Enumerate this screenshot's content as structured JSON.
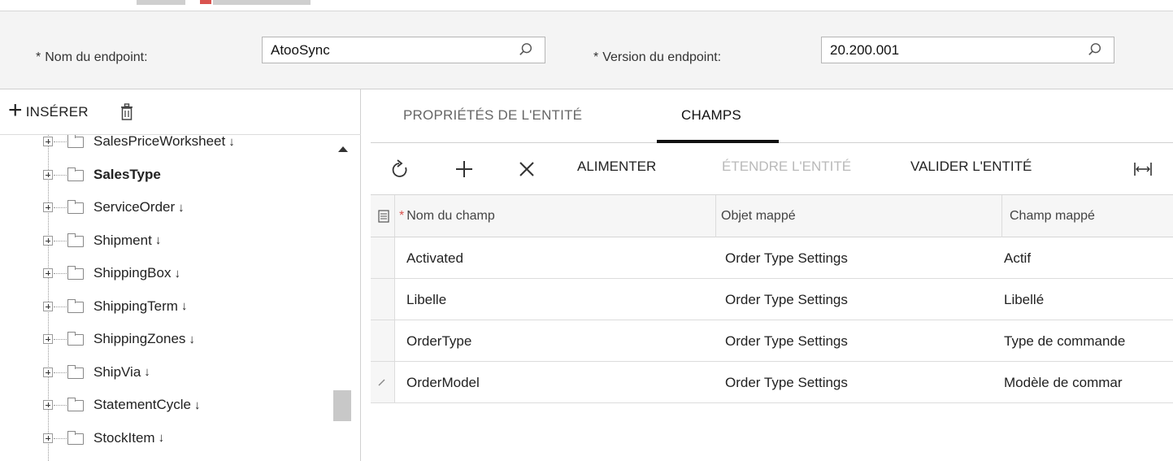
{
  "form": {
    "endpoint_name_label": "Nom du endpoint:",
    "endpoint_name_value": "AtooSync",
    "endpoint_version_label": "Version du endpoint:",
    "endpoint_version_value": "20.200.001"
  },
  "left_toolbar": {
    "insert_label": "INSÉRER"
  },
  "tree": {
    "items": [
      {
        "label": "SalesPriceWorksheet",
        "arrow": "↓"
      },
      {
        "label": "SalesType",
        "arrow": ""
      },
      {
        "label": "ServiceOrder",
        "arrow": "↓"
      },
      {
        "label": "Shipment",
        "arrow": "↓"
      },
      {
        "label": "ShippingBox",
        "arrow": "↓"
      },
      {
        "label": "ShippingTerm",
        "arrow": "↓"
      },
      {
        "label": "ShippingZones",
        "arrow": "↓"
      },
      {
        "label": "ShipVia",
        "arrow": "↓"
      },
      {
        "label": "StatementCycle",
        "arrow": "↓"
      },
      {
        "label": "StockItem",
        "arrow": "↓"
      }
    ]
  },
  "tabs": {
    "properties": "PROPRIÉTÉS DE L'ENTITÉ",
    "fields": "CHAMPS"
  },
  "grid_toolbar": {
    "populate": "ALIMENTER",
    "extend": "ÉTENDRE L'ENTITÉ",
    "validate": "VALIDER L'ENTITÉ"
  },
  "grid": {
    "headers": [
      "Nom du champ",
      "Objet mappé",
      "Champ mappé"
    ],
    "rows": [
      [
        "Activated",
        "Order Type Settings",
        "Actif"
      ],
      [
        "Libelle",
        "Order Type Settings",
        "Libellé"
      ],
      [
        "OrderType",
        "Order Type Settings",
        "Type de commande"
      ],
      [
        "OrderModel",
        "Order Type Settings",
        "Modèle de commar"
      ]
    ]
  },
  "colors": {
    "required": "#d9534f",
    "active_tab_underline": "#111111"
  }
}
